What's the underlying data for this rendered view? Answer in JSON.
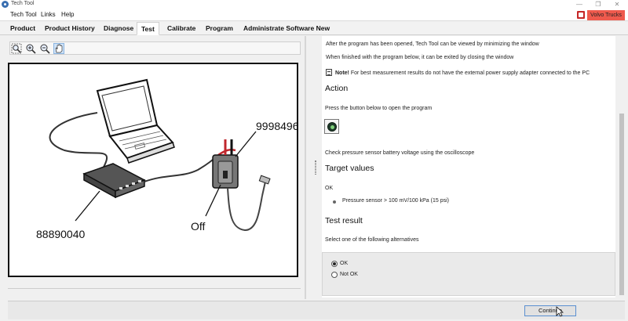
{
  "window": {
    "title": "Tech Tool"
  },
  "menu": {
    "items": [
      "Tech Tool",
      "Links",
      "Help"
    ],
    "badge": "Volvo Trucks"
  },
  "tabs": [
    {
      "label": "Product"
    },
    {
      "label": "Product History"
    },
    {
      "label": "Diagnose"
    },
    {
      "label": "Test",
      "active": true
    },
    {
      "label": "Calibrate"
    },
    {
      "label": "Program"
    },
    {
      "label": "Administrate Software New"
    }
  ],
  "toolbar": {
    "tools": [
      "zoom-fit-icon",
      "zoom-in-icon",
      "zoom-out-icon",
      "pan-hand-icon"
    ]
  },
  "diagram": {
    "label_top": "9998496",
    "label_left": "88890040",
    "label_off": "Off"
  },
  "instructions": {
    "line1": "After the program has been opened, Tech Tool can be viewed by minimizing the window",
    "line2": "When finished with the program below, it can be exited by closing the window",
    "note_bold": "Note!",
    "note_text": " For best measurement results do not have the external power supply adapter connected to the PC"
  },
  "action": {
    "heading": "Action",
    "text": "Press the button below to open the program",
    "check_text": "Check pressure sensor battery voltage using the oscilloscope"
  },
  "target": {
    "heading": "Target values",
    "ok": "OK",
    "value": "Pressure sensor > 100 mV/100 kPa (15 psi)"
  },
  "result": {
    "heading": "Test result",
    "prompt": "Select one of the following alternatives",
    "options": [
      {
        "label": "OK",
        "checked": true
      },
      {
        "label": "Not OK",
        "checked": false
      }
    ]
  },
  "footer": {
    "continue_label": "Continue"
  },
  "colors": {
    "badge": "#ef5a4d",
    "button_border": "#5a8fd0"
  }
}
